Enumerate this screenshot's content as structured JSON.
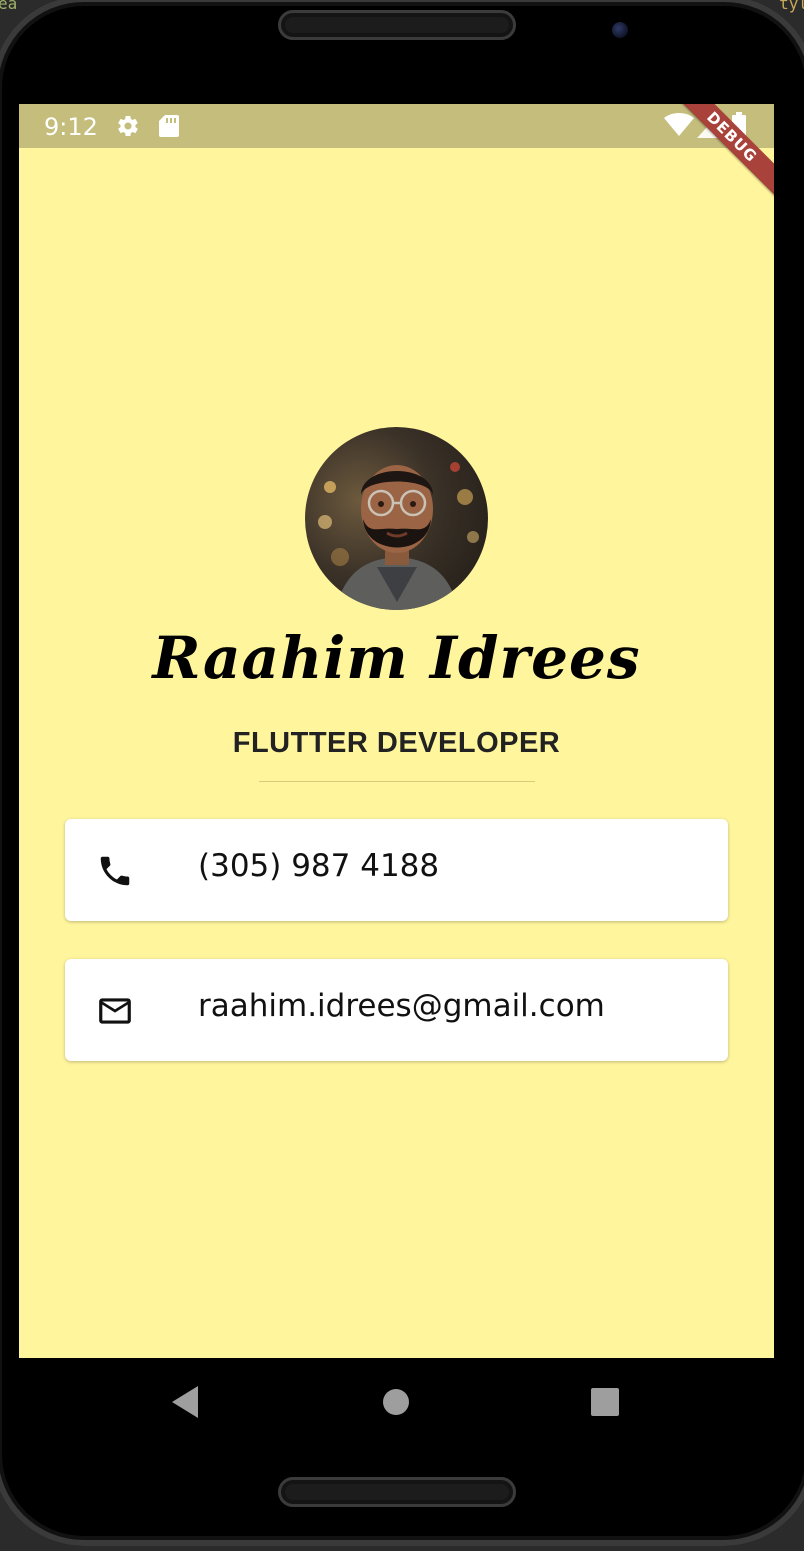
{
  "ide_fragments": {
    "left": "ea",
    "right": "tyl"
  },
  "status_bar": {
    "time": "9:12",
    "icons": [
      "settings-icon",
      "sd-card-icon",
      "wifi-icon",
      "signal-icon",
      "battery-icon"
    ],
    "debug_banner": "DEBUG"
  },
  "profile": {
    "name": "Raahim Idrees",
    "title": "FLUTTER DEVELOPER"
  },
  "contacts": [
    {
      "icon": "phone-icon",
      "text": "(305) 987 4188"
    },
    {
      "icon": "mail-icon",
      "text": "raahim.idrees@gmail.com"
    }
  ],
  "nav_bar": {
    "buttons": [
      "back-icon",
      "home-icon",
      "recents-icon"
    ]
  },
  "colors": {
    "background": "#fff59d",
    "status_bar": "#c5bd7c",
    "card": "#ffffff",
    "debug_ribbon": "#a8423a",
    "divider": "#d9c97a"
  }
}
